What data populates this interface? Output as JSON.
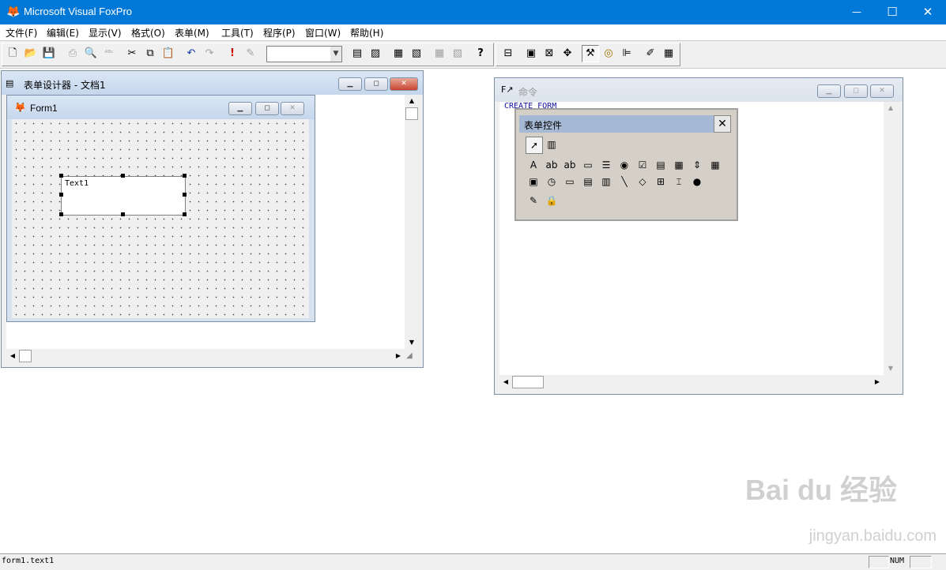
{
  "app": {
    "title": "Microsoft Visual FoxPro",
    "window_controls": {
      "minimize": "—",
      "maximize": "☐",
      "close": "✕"
    }
  },
  "menu": [
    "文件(F)",
    "编辑(E)",
    "显示(V)",
    "格式(O)",
    "表单(M)",
    "工具(T)",
    "程序(P)",
    "窗口(W)",
    "帮助(H)"
  ],
  "toolbar": {
    "icons": [
      "new-file-icon",
      "open-folder-icon",
      "save-disk-icon",
      "print-icon",
      "print-preview-icon",
      "spell-check-icon",
      "cut-icon",
      "copy-icon",
      "paste-icon",
      "undo-icon",
      "redo-icon",
      "run-icon",
      "modify-icon",
      "form-icon",
      "report-icon",
      "database-icon",
      "form-wizard-icon",
      "autoform-icon",
      "autoreport-icon",
      "help-icon",
      "layout-toolbar-icon",
      "form-designer-icon",
      "properties-icon",
      "code-window-icon",
      "form-controls-toolbar-icon",
      "color-palette-icon",
      "layout-icon",
      "form-builder-icon",
      "autoformat-icon"
    ],
    "combo_value": ""
  },
  "form_designer": {
    "title": "表单设计器 - 文档1",
    "form": {
      "title": "Form1",
      "textbox_text": "Text1"
    }
  },
  "command_window": {
    "title": "命令",
    "content": "CREATE FORM"
  },
  "form_controls": {
    "title": "表单控件",
    "close_label": "✕",
    "top_buttons": [
      {
        "name": "select-objects-icon",
        "glyph": "➚"
      },
      {
        "name": "view-classes-icon",
        "glyph": "▥"
      }
    ],
    "row1": [
      {
        "name": "label-icon",
        "glyph": "A"
      },
      {
        "name": "textbox-icon",
        "glyph": "ab"
      },
      {
        "name": "editbox-icon",
        "glyph": "ab"
      },
      {
        "name": "commandbutton-icon",
        "glyph": "▭"
      },
      {
        "name": "commandgroup-icon",
        "glyph": "☰"
      },
      {
        "name": "optiongroup-icon",
        "glyph": "◉"
      },
      {
        "name": "checkbox-icon",
        "glyph": "☑"
      },
      {
        "name": "combobox-icon",
        "glyph": "▤"
      },
      {
        "name": "listbox-icon",
        "glyph": "▦"
      },
      {
        "name": "spinner-icon",
        "glyph": "⇕"
      },
      {
        "name": "grid-icon",
        "glyph": "▦"
      }
    ],
    "row2": [
      {
        "name": "image-icon",
        "glyph": "▣"
      },
      {
        "name": "timer-icon",
        "glyph": "◷"
      },
      {
        "name": "pageframe-icon",
        "glyph": "▭"
      },
      {
        "name": "activex-control-icon",
        "glyph": "▤"
      },
      {
        "name": "activex-bound-icon",
        "glyph": "▥"
      },
      {
        "name": "line-icon",
        "glyph": "╲"
      },
      {
        "name": "shape-icon",
        "glyph": "◇"
      },
      {
        "name": "container-icon",
        "glyph": "⊞"
      },
      {
        "name": "separator-icon",
        "glyph": "⌶"
      },
      {
        "name": "hyperlink-icon",
        "glyph": "●"
      }
    ],
    "row3": [
      {
        "name": "builder-lock-icon",
        "glyph": "✎"
      },
      {
        "name": "button-lock-icon",
        "glyph": "🔒"
      }
    ]
  },
  "statusbar": {
    "text": "form1.text1",
    "num": "NUM"
  },
  "watermark": {
    "brand": "Bai du 经验",
    "url": "jingyan.baidu.com"
  },
  "colors": {
    "titlebar": "#0078d7",
    "mdi_title": "#c5d6ec",
    "palette_title": "#a6b9d4"
  }
}
